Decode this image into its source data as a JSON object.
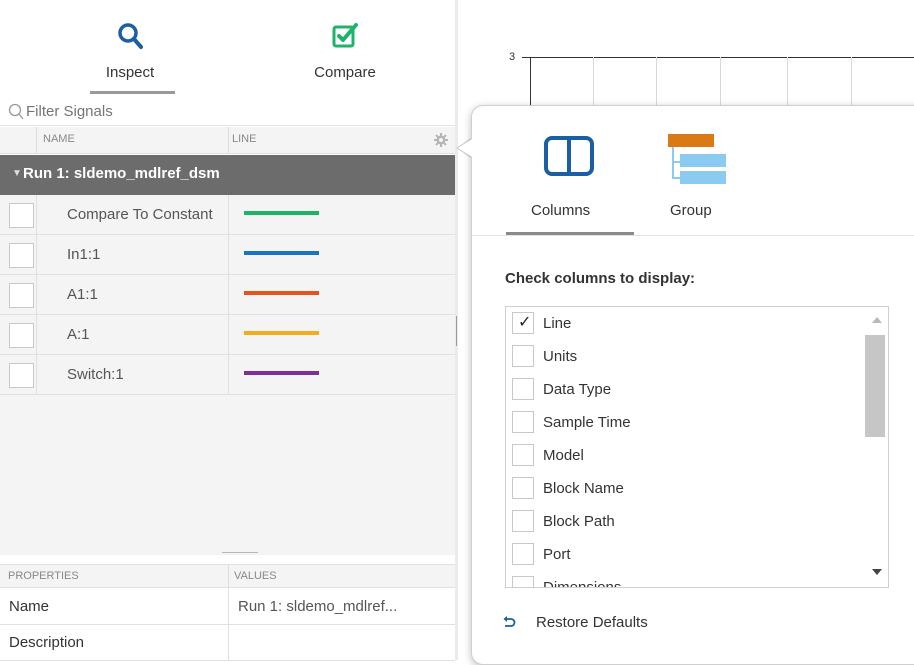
{
  "mode_tabs": {
    "inspect": "Inspect",
    "compare": "Compare"
  },
  "filter": {
    "placeholder": "Filter Signals"
  },
  "signal_table": {
    "headers": {
      "name": "NAME",
      "line": "LINE"
    },
    "run_label": "Run 1: sldemo_mdlref_dsm",
    "signals": [
      {
        "name": "Compare To Constant",
        "color": "#1db36a"
      },
      {
        "name": "In1:1",
        "color": "#1a74c6"
      },
      {
        "name": "A1:1",
        "color": "#e2561b"
      },
      {
        "name": "A:1",
        "color": "#f0ad1c"
      },
      {
        "name": "Switch:1",
        "color": "#7c2f96"
      }
    ]
  },
  "properties": {
    "headers": {
      "key": "PROPERTIES",
      "value": "VALUES"
    },
    "rows": [
      {
        "key": "Name",
        "value": "Run 1: sldemo_mdlref..."
      },
      {
        "key": "Description",
        "value": ""
      }
    ]
  },
  "plot": {
    "y_tick_label": "3"
  },
  "popup": {
    "tabs": {
      "columns": "Columns",
      "group": "Group"
    },
    "title": "Check columns to display:",
    "columns": [
      {
        "label": "Line",
        "checked": true
      },
      {
        "label": "Units",
        "checked": false
      },
      {
        "label": "Data Type",
        "checked": false
      },
      {
        "label": "Sample Time",
        "checked": false
      },
      {
        "label": "Model",
        "checked": false
      },
      {
        "label": "Block Name",
        "checked": false
      },
      {
        "label": "Block Path",
        "checked": false
      },
      {
        "label": "Port",
        "checked": false
      },
      {
        "label": "Dimensions",
        "checked": false
      }
    ],
    "check_mark": "✓",
    "restore_label": "Restore Defaults"
  },
  "colors": {
    "accent_blue": "#1a5ea3",
    "compare_green": "#1db36a",
    "group_orange": "#d97a14",
    "group_light_blue": "#8ccbf1",
    "run_header_gray": "#6c6c6c"
  }
}
